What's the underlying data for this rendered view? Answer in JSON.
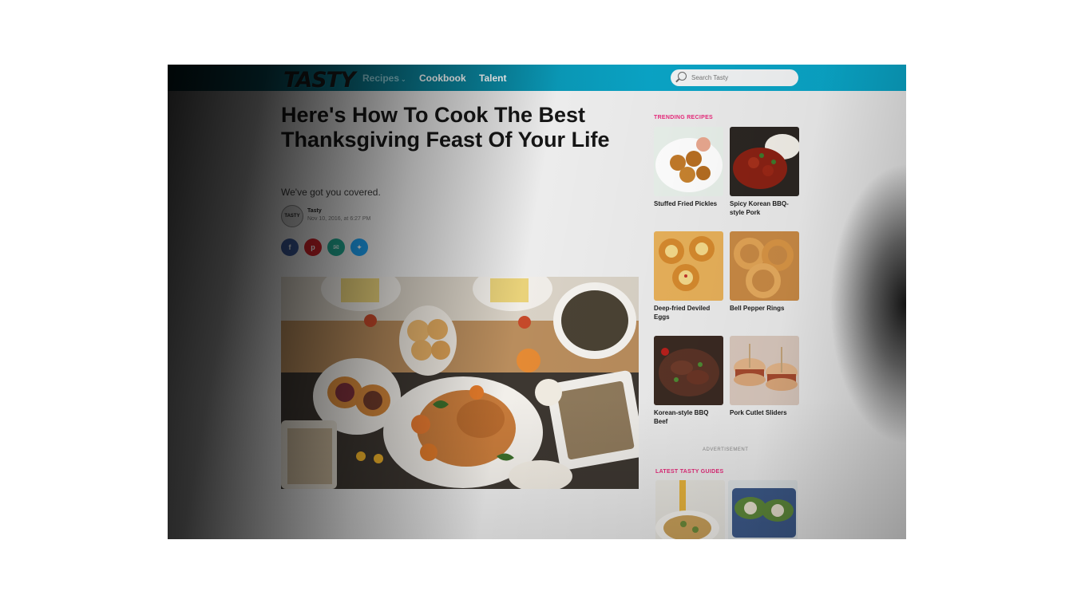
{
  "header": {
    "logo": "TASTY",
    "nav": [
      {
        "label": "Recipes"
      },
      {
        "label": "Cookbook"
      },
      {
        "label": "Talent"
      }
    ],
    "search_placeholder": "Search Tasty"
  },
  "article": {
    "title": "Here's How To Cook The Best Thanksgiving Feast Of Your Life",
    "subtitle": "We've got you covered.",
    "avatar_text": "TASTY",
    "author": "Tasty",
    "date": "Nov 10, 2016, at 6:27 PM",
    "share_icons": [
      "facebook-icon",
      "pinterest-icon",
      "email-icon",
      "twitter-icon"
    ]
  },
  "sidebar": {
    "trending_heading": "TRENDING RECIPES",
    "trending": [
      {
        "label": "Stuffed Fried Pickles"
      },
      {
        "label": "Spicy Korean BBQ-style Pork"
      },
      {
        "label": "Deep-fried Deviled Eggs"
      },
      {
        "label": "Bell Pepper Rings"
      },
      {
        "label": "Korean-style BBQ Beef"
      },
      {
        "label": "Pork Cutlet Sliders"
      }
    ],
    "ad_label": "ADVERTISEMENT",
    "guides_heading": "LATEST TASTY GUIDES"
  },
  "colors": {
    "header_accent": "#0aa6c8",
    "trending_pink": "#e8297b",
    "facebook": "#3b5998",
    "pinterest": "#cb2027",
    "email": "#20a58e",
    "twitter": "#1da1f2"
  }
}
